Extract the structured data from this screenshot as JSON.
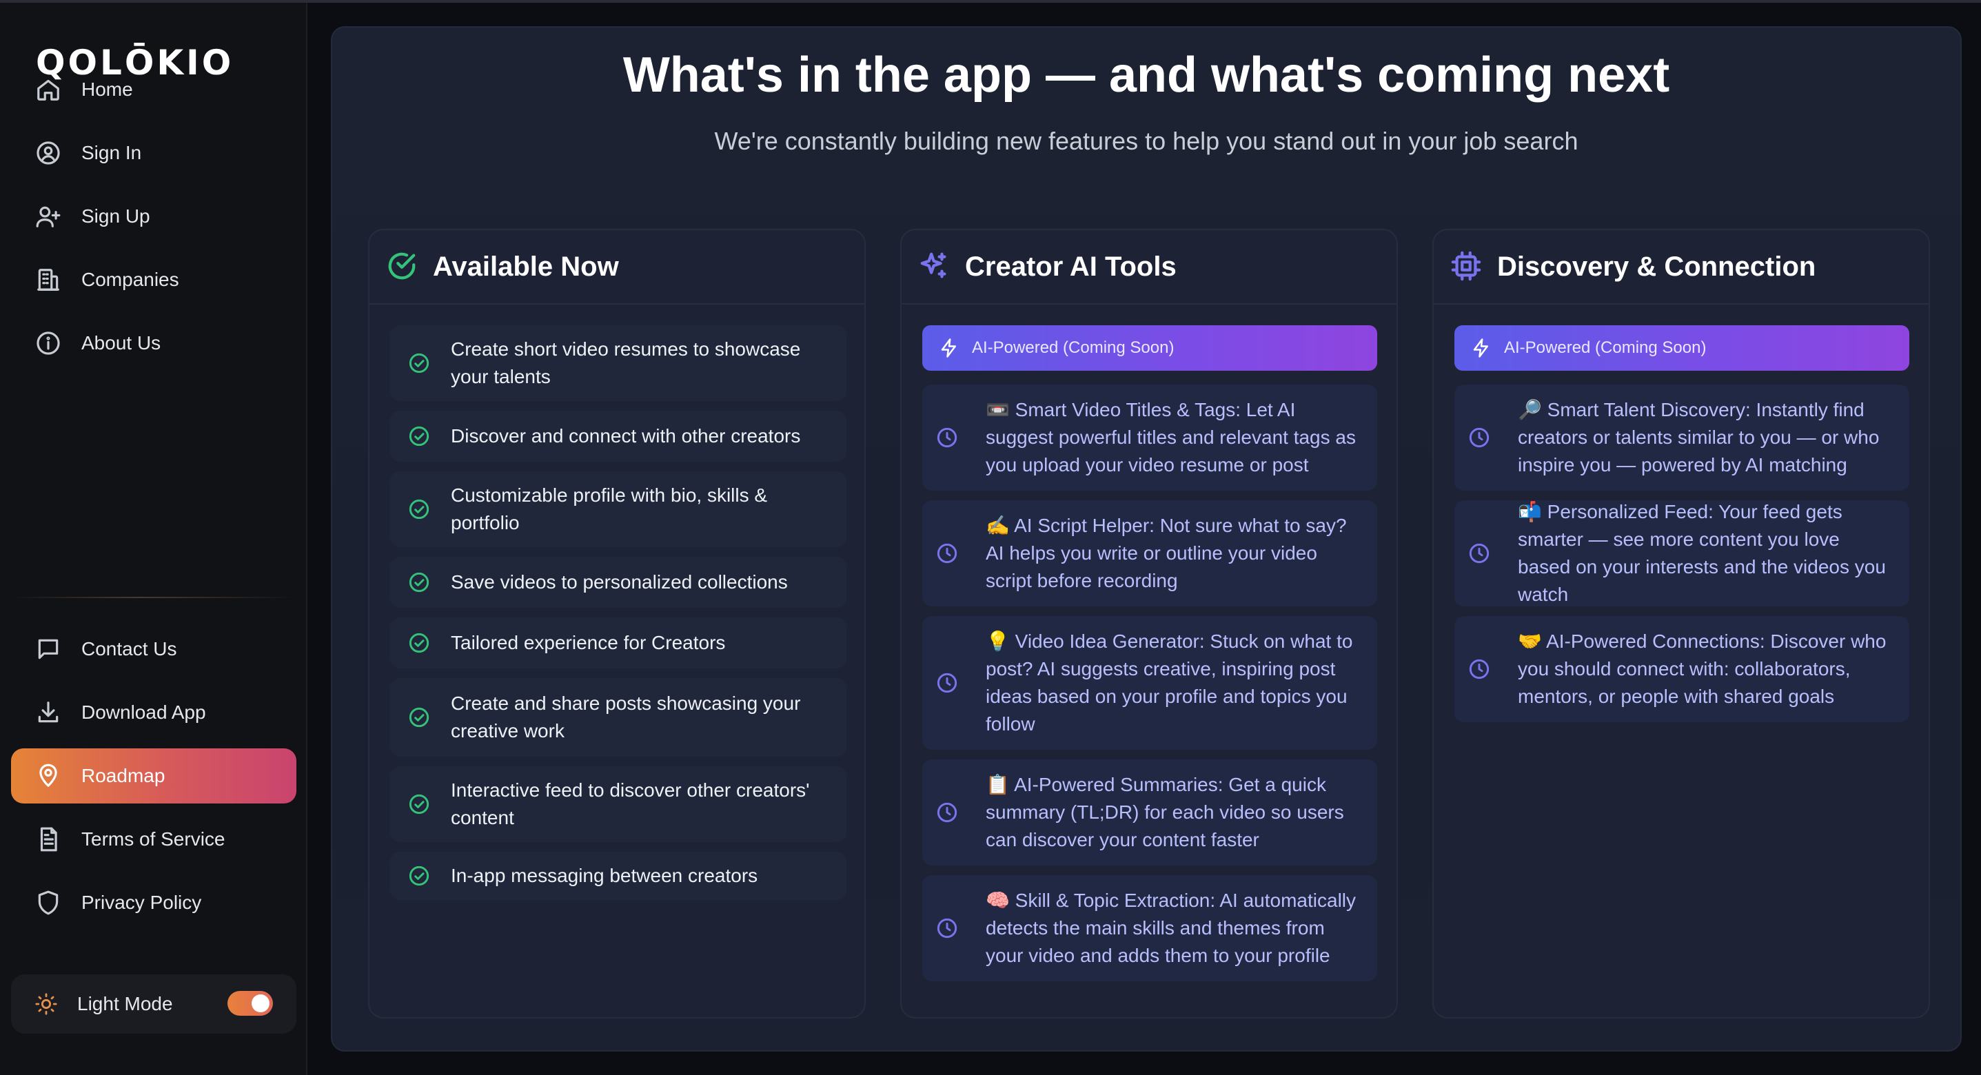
{
  "brand": {
    "logo_text": "QOLŌKIO"
  },
  "sidebar": {
    "items": [
      {
        "label": "Home",
        "icon": "home-icon"
      },
      {
        "label": "Sign In",
        "icon": "user-circle-icon"
      },
      {
        "label": "Sign Up",
        "icon": "user-plus-icon"
      },
      {
        "label": "Companies",
        "icon": "building-icon"
      },
      {
        "label": "About Us",
        "icon": "info-icon"
      }
    ],
    "bottom_items": [
      {
        "label": "Contact Us",
        "icon": "message-icon"
      },
      {
        "label": "Download App",
        "icon": "download-icon"
      },
      {
        "label": "Roadmap",
        "icon": "map-pin-icon",
        "active": true
      },
      {
        "label": "Terms of Service",
        "icon": "document-icon"
      },
      {
        "label": "Privacy Policy",
        "icon": "shield-icon"
      }
    ],
    "theme_toggle": {
      "label": "Light Mode",
      "icon": "sun-icon",
      "on": true
    }
  },
  "main": {
    "title": "What's in the app — and what's coming next",
    "subtitle": "We're constantly building new features to help you stand out in your job search",
    "columns": [
      {
        "title": "Available Now",
        "icon": "check-circle-icon",
        "items": [
          "Create short video resumes to showcase your talents",
          "Discover and connect with other creators",
          "Customizable profile with bio, skills & portfolio",
          "Save videos to personalized collections",
          "Tailored experience for Creators",
          "Create and share posts showcasing your creative work",
          "Interactive feed to discover other creators' content",
          "In-app messaging between creators"
        ]
      },
      {
        "title": "Creator AI Tools",
        "icon": "sparkles-icon",
        "badge": "AI-Powered (Coming Soon)",
        "items": [
          "📼 Smart Video Titles & Tags: Let AI suggest powerful titles and relevant tags as you upload your video resume or post",
          "✍️ AI Script Helper: Not sure what to say? AI helps you write or outline your video script before recording",
          "💡 Video Idea Generator: Stuck on what to post? AI suggests creative, inspiring post ideas based on your profile and topics you follow",
          "📋 AI-Powered Summaries: Get a quick summary (TL;DR) for each video so users can discover your content faster",
          "🧠 Skill & Topic Extraction: AI automatically detects the main skills and themes from your video and adds them to your profile"
        ]
      },
      {
        "title": "Discovery & Connection",
        "icon": "cpu-chip-icon",
        "badge": "AI-Powered (Coming Soon)",
        "items": [
          "🔎 Smart Talent Discovery: Instantly find creators or talents similar to you — or who inspire you — powered by AI matching",
          "📬 Personalized Feed: Your feed gets smarter — see more content you love based on your interests and the videos you watch",
          "🤝 AI-Powered Connections: Discover who you should connect with: collaborators, mentors, or people with shared goals"
        ]
      }
    ]
  },
  "colors": {
    "accent_gradient_start": "#e58437",
    "accent_gradient_end": "#c9446f",
    "available_check": "#35c27a",
    "ai_badge_start": "#5b5de8",
    "ai_badge_end": "#8f45df",
    "coming_soon_text": "#b9befc"
  }
}
